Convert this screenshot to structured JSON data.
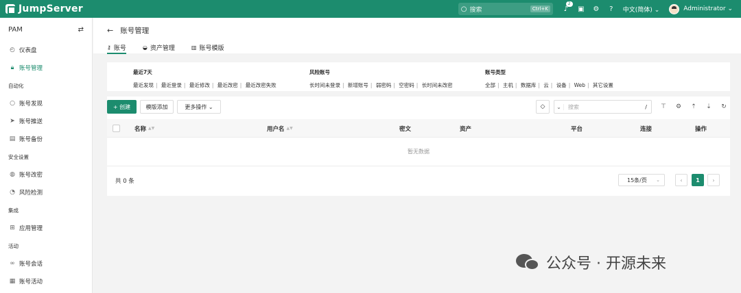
{
  "app": {
    "brand": "JumpServer"
  },
  "topbar": {
    "search_placeholder": "搜索",
    "search_shortcut": "Ctrl+K",
    "notification_count": "2",
    "language": "中文(简体)",
    "user_name": "Administrator"
  },
  "sidebar": {
    "title": "PAM",
    "items": [
      {
        "label": "仪表盘",
        "icon": "dashboard-icon"
      },
      {
        "label": "账号管理",
        "icon": "lock-icon",
        "active": true
      }
    ],
    "sections": [
      {
        "label": "自动化",
        "items": [
          {
            "label": "账号发现",
            "icon": "search-icon"
          },
          {
            "label": "账号推送",
            "icon": "send-icon"
          },
          {
            "label": "账号备份",
            "icon": "backup-icon"
          }
        ]
      },
      {
        "label": "安全设置",
        "items": [
          {
            "label": "账号改密",
            "icon": "lock-rotate-icon"
          },
          {
            "label": "风险检测",
            "icon": "risk-icon"
          }
        ]
      },
      {
        "label": "集成",
        "items": [
          {
            "label": "应用管理",
            "icon": "app-icon"
          }
        ]
      },
      {
        "label": "活动",
        "items": [
          {
            "label": "账号会话",
            "icon": "link-icon"
          },
          {
            "label": "账号活动",
            "icon": "activity-icon"
          }
        ]
      }
    ]
  },
  "page": {
    "title": "账号管理",
    "tabs": [
      {
        "label": "账号",
        "active": true
      },
      {
        "label": "资产管理"
      },
      {
        "label": "账号模版"
      }
    ]
  },
  "filters": {
    "recent": {
      "title": "最近7天",
      "items": [
        "最近发现",
        "最近登录",
        "最近修改",
        "最近改密",
        "最近改密失败"
      ]
    },
    "risk": {
      "title": "风险账号",
      "items": [
        "长时间未登录",
        "新增账号",
        "弱密码",
        "空密码",
        "长时间未改密"
      ]
    },
    "type": {
      "title": "账号类型",
      "items": [
        "全部",
        "主机",
        "数据库",
        "云",
        "设备",
        "Web",
        "其它设置"
      ]
    }
  },
  "toolbar": {
    "create_label": "+ 创建",
    "template_add_label": "模版添加",
    "more_label": "更多操作",
    "search_placeholder": "搜索"
  },
  "table": {
    "columns": [
      "名称",
      "用户名",
      "密文",
      "资产",
      "平台",
      "连接",
      "操作"
    ],
    "empty_text": "暂无数据",
    "total_text": "共 0 条",
    "page_size": "15条/页",
    "current_page": "1"
  },
  "footer_brand": "公众号 · 开源未来"
}
